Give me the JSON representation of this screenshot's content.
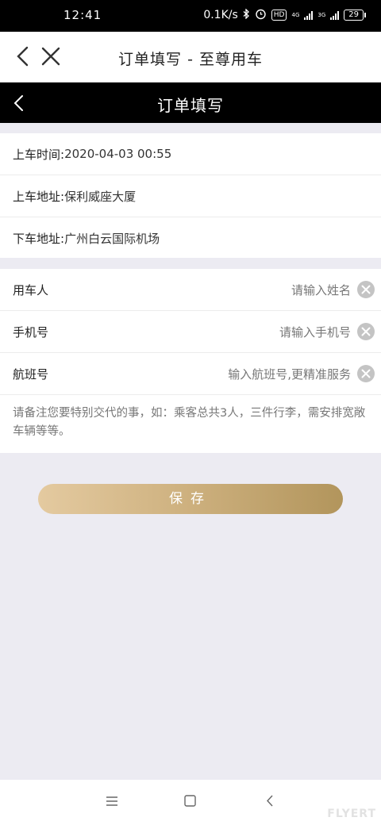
{
  "status_bar": {
    "time": "12:41",
    "network_speed": "0.1K/s",
    "hd": "HD",
    "net1": "4G",
    "net2": "3G",
    "battery": "29"
  },
  "web_bar": {
    "title": "订单填写 - 至尊用车"
  },
  "app_header": {
    "title": "订单填写"
  },
  "trip_info": [
    {
      "label": "上车时间:",
      "value": "2020-04-03 00:55"
    },
    {
      "label": "上车地址:",
      "value": "保利威座大厦"
    },
    {
      "label": "下车地址:",
      "value": "广州白云国际机场"
    }
  ],
  "form": {
    "passenger": {
      "label": "用车人",
      "placeholder": "请输入姓名"
    },
    "phone": {
      "label": "手机号",
      "placeholder": "请输入手机号"
    },
    "flight": {
      "label": "航班号",
      "placeholder": "输入航班号,更精准服务"
    },
    "remark_placeholder": "请备注您要特别交代的事，如：乘客总共3人，三件行李，需安排宽敞车辆等等。"
  },
  "save_label": "保存",
  "watermark": "FLYERT",
  "colors": {
    "header_bg": "#000000",
    "page_bg": "#ecebf2",
    "save_gradient_start": "#e4caa0",
    "save_gradient_end": "#b2955c"
  }
}
